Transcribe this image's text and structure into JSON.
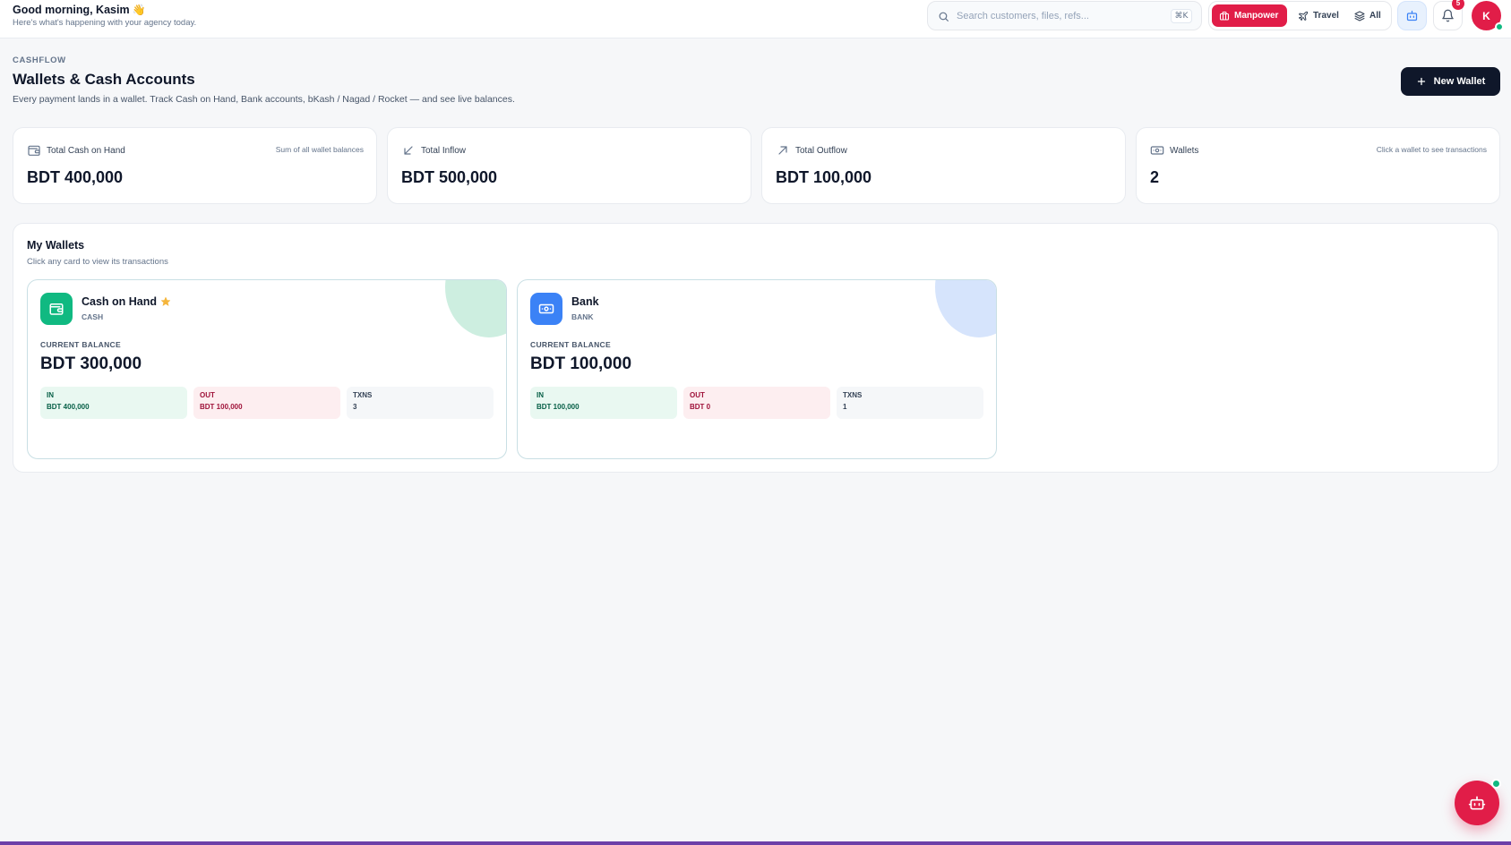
{
  "header": {
    "greeting": "Good morning, Kasim",
    "greeting_emoji": "👋",
    "subtitle": "Here's what's happening with your agency today.",
    "search_placeholder": "Search customers, files, refs...",
    "search_shortcut": "⌘K",
    "modes": [
      {
        "label": "Manpower",
        "active": true
      },
      {
        "label": "Travel",
        "active": false
      },
      {
        "label": "All",
        "active": false
      }
    ],
    "notifications_count": "5",
    "avatar_initial": "K"
  },
  "page": {
    "eyebrow": "CASHFLOW",
    "title": "Wallets & Cash Accounts",
    "subtitle": "Every payment lands in a wallet. Track Cash on Hand, Bank accounts, bKash / Nagad / Rocket — and see live balances.",
    "new_wallet_label": "New Wallet"
  },
  "stats": [
    {
      "label": "Total Cash on Hand",
      "hint": "Sum of all wallet balances",
      "value": "BDT 400,000",
      "icon": "wallet-icon"
    },
    {
      "label": "Total Inflow",
      "hint": "",
      "value": "BDT 500,000",
      "icon": "arrow-down-left-icon"
    },
    {
      "label": "Total Outflow",
      "hint": "",
      "value": "BDT 100,000",
      "icon": "arrow-up-right-icon"
    },
    {
      "label": "Wallets",
      "hint": "Click a wallet to see transactions",
      "value": "2",
      "icon": "banknote-icon"
    }
  ],
  "wallets_panel": {
    "title": "My Wallets",
    "subtitle": "Click any card to view its transactions",
    "balance_label": "CURRENT BALANCE",
    "in_label": "IN",
    "out_label": "OUT",
    "txns_label": "TXNS",
    "wallets": [
      {
        "name": "Cash on Hand",
        "type": "CASH",
        "default": true,
        "balance": "BDT 300,000",
        "in": "BDT 400,000",
        "out": "BDT 100,000",
        "txns": "3",
        "color": "#10b981",
        "blob": "#cdeee0"
      },
      {
        "name": "Bank",
        "type": "BANK",
        "default": false,
        "balance": "BDT 100,000",
        "in": "BDT 100,000",
        "out": "BDT 0",
        "txns": "1",
        "color": "#3b82f6",
        "blob": "#d6e4fc"
      }
    ]
  },
  "colors": {
    "brand": "#e11d48",
    "dark": "#0f172a",
    "success": "#10b981"
  }
}
